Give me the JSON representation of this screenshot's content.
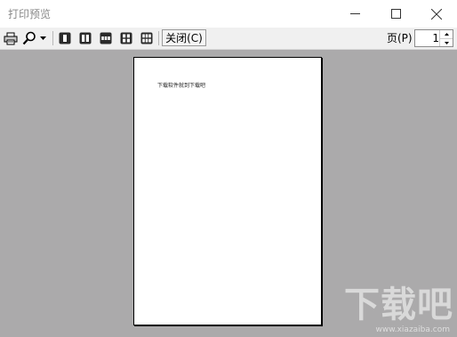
{
  "window": {
    "title": "打印预览"
  },
  "toolbar": {
    "close_label": "关闭(C)",
    "page_label": "页(P)",
    "page_value": "1",
    "icons": [
      "print-icon",
      "zoom-icon",
      "dropdown-arrow-icon",
      "one-page-icon",
      "two-page-icon",
      "three-page-icon",
      "four-page-icon",
      "six-page-icon"
    ]
  },
  "preview": {
    "page_text": "下载软件就到下载吧"
  },
  "watermark": {
    "brand": "下载吧",
    "url": "www.xiazaiba.com"
  },
  "colors": {
    "preview_bg": "#abaaab",
    "toolbar_bg": "#f0f0f0",
    "title_text": "#8a8a8a"
  }
}
